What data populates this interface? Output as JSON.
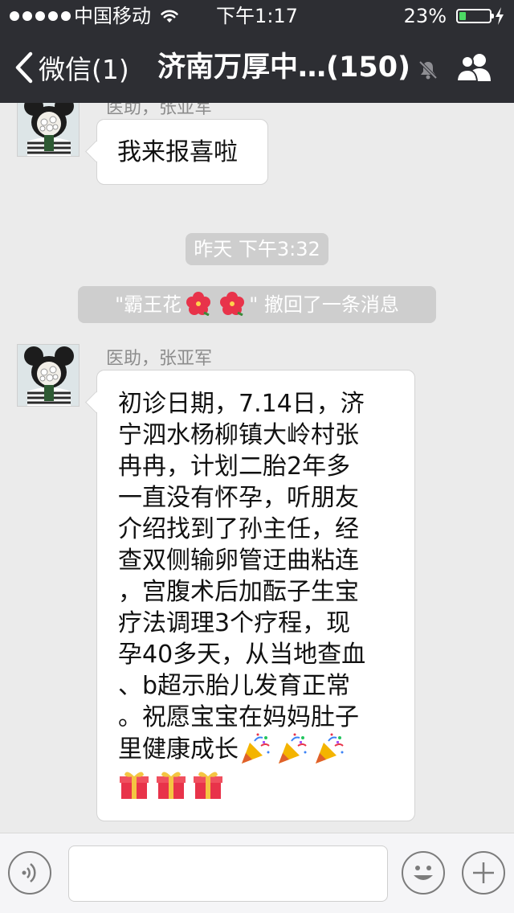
{
  "status_bar": {
    "carrier": "中国移动",
    "time": "下午1:17",
    "battery": "23%",
    "battery_level": 0.23
  },
  "nav": {
    "back_label": "微信(1)",
    "title": "济南万厚中…(150)"
  },
  "messages": [
    {
      "sender": "医助，张亚军",
      "text": "我来报喜啦"
    },
    {
      "sender": "医助，张亚军",
      "lines": [
        "初诊日期，7.14日，济",
        "宁泗水杨柳镇大岭村张",
        "冉冉，计划二胎2年多",
        "一直没有怀孕，听朋友",
        "介绍找到了孙主任，经",
        "查双侧输卵管迂曲粘连",
        "，宫腹术后加酝子生宝",
        "疗法调理3个疗程，现",
        "孕40多天，从当地查血",
        "、b超示胎儿发育正常",
        "。祝愿宝宝在妈妈肚子",
        "里健康成长"
      ]
    }
  ],
  "timestamp": "昨天 下午3:32",
  "recall_notice": {
    "prefix": "\"霸王花",
    "suffix": "\" 撤回了一条消息"
  },
  "icons": {
    "back": "chevron-left-icon",
    "mute": "mute-bell-icon",
    "members": "group-members-icon",
    "voice": "voice-icon",
    "emoji": "smiley-icon",
    "more": "plus-icon",
    "celebrate": "party-popper-icon",
    "gift": "gift-icon",
    "flower": "hibiscus-icon"
  },
  "colors": {
    "nav_bg": "#2d2e33",
    "chat_bg": "#ebebeb",
    "battery_green": "#4cd964"
  }
}
